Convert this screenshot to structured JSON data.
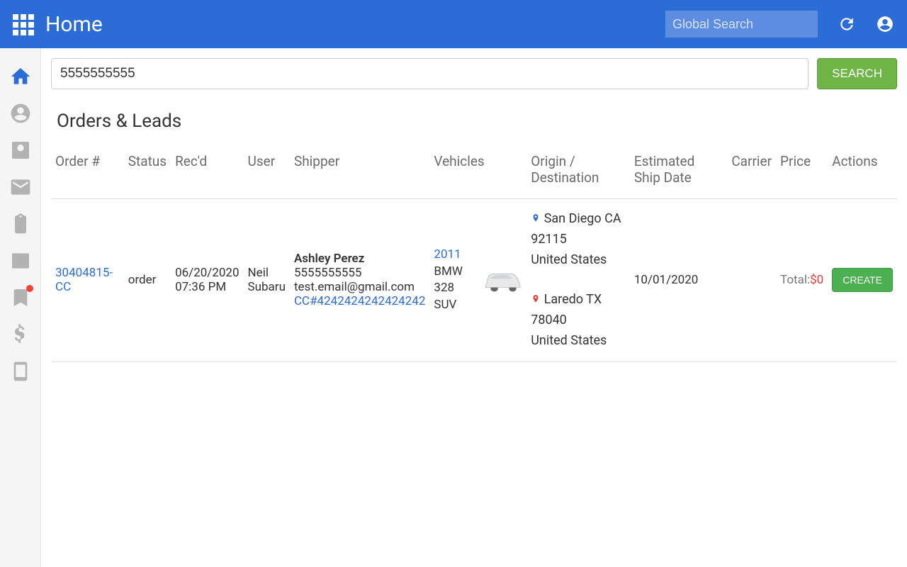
{
  "header": {
    "title": "Home",
    "global_search_placeholder": "Global Search"
  },
  "search": {
    "value": "5555555555",
    "button": "SEARCH"
  },
  "section_title": "Orders & Leads",
  "columns": {
    "order": "Order #",
    "status": "Status",
    "recd": "Rec'd",
    "user": "User",
    "shipper": "Shipper",
    "vehicles": "Vehicles",
    "origin_dest": "Origin / Destination",
    "est_ship": "Estimated Ship Date",
    "carrier": "Carrier",
    "price": "Price",
    "actions": "Actions"
  },
  "row": {
    "order_id": "30404815-CC",
    "status": "order",
    "recd_date": "06/20/2020",
    "recd_time": "07:36 PM",
    "user_first": "Neil",
    "user_last": "Subaru",
    "shipper_name": "Ashley Perez",
    "shipper_phone": "5555555555",
    "shipper_email": "test.email@gmail.com",
    "shipper_cc": "CC#4242424242424242",
    "vehicle_year": "2011",
    "vehicle_model": "BMW 328",
    "vehicle_type": "SUV",
    "origin_city": "San Diego CA 92115",
    "origin_country": "United States",
    "dest_city": "Laredo TX 78040",
    "dest_country": "United States",
    "est_ship_date": "10/01/2020",
    "carrier": "",
    "price_label": "Total:",
    "price_amount": "$0",
    "action_button": "CREATE"
  }
}
